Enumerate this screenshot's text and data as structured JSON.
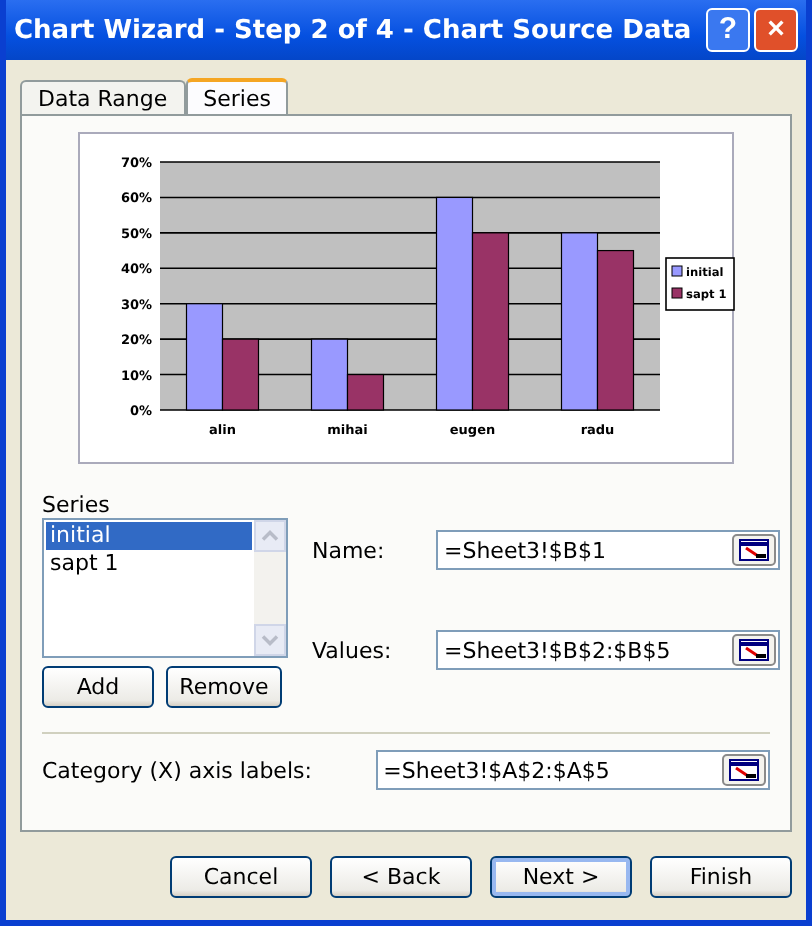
{
  "window": {
    "title": "Chart Wizard - Step 2 of 4 - Chart Source Data",
    "help": "?",
    "close": "×"
  },
  "tabs": [
    {
      "label": "Data Range",
      "selected": false
    },
    {
      "label": "Series",
      "selected": true
    }
  ],
  "chart_data": {
    "type": "bar",
    "categories": [
      "alin",
      "mihai",
      "eugen",
      "radu"
    ],
    "yticks": [
      {
        "value": 0,
        "label": "0%"
      },
      {
        "value": 0.1,
        "label": "10%"
      },
      {
        "value": 0.2,
        "label": "20%"
      },
      {
        "value": 0.3,
        "label": "30%"
      },
      {
        "value": 0.4,
        "label": "40%"
      },
      {
        "value": 0.5,
        "label": "50%"
      },
      {
        "value": 0.6,
        "label": "60%"
      },
      {
        "value": 0.7,
        "label": "70%"
      }
    ],
    "ylim": [
      0,
      0.7
    ],
    "grid": true,
    "legend": true,
    "series": [
      {
        "name": "initial",
        "color": "#9999ff",
        "values": [
          0.3,
          0.2,
          0.6,
          0.5
        ]
      },
      {
        "name": "sapt 1",
        "color": "#993366",
        "values": [
          0.2,
          0.1,
          0.5,
          0.45
        ]
      }
    ]
  },
  "series_label": "Series",
  "series_list": [
    {
      "label": "initial",
      "selected": true
    },
    {
      "label": "sapt 1",
      "selected": false
    }
  ],
  "series_buttons": [
    "Add",
    "Remove"
  ],
  "fields": [
    {
      "label": "Name:",
      "value": "=Sheet3!$B$1"
    },
    {
      "label": "Values:",
      "value": "=Sheet3!$B$2:$B$5"
    }
  ],
  "category": {
    "label": "Category (X) axis labels:",
    "value": "=Sheet3!$A$2:$A$5"
  },
  "buttons": [
    {
      "label": "Cancel",
      "default": false
    },
    {
      "label": "< Back",
      "default": false
    },
    {
      "label": "Next >",
      "default": true
    },
    {
      "label": "Finish",
      "default": false
    }
  ]
}
